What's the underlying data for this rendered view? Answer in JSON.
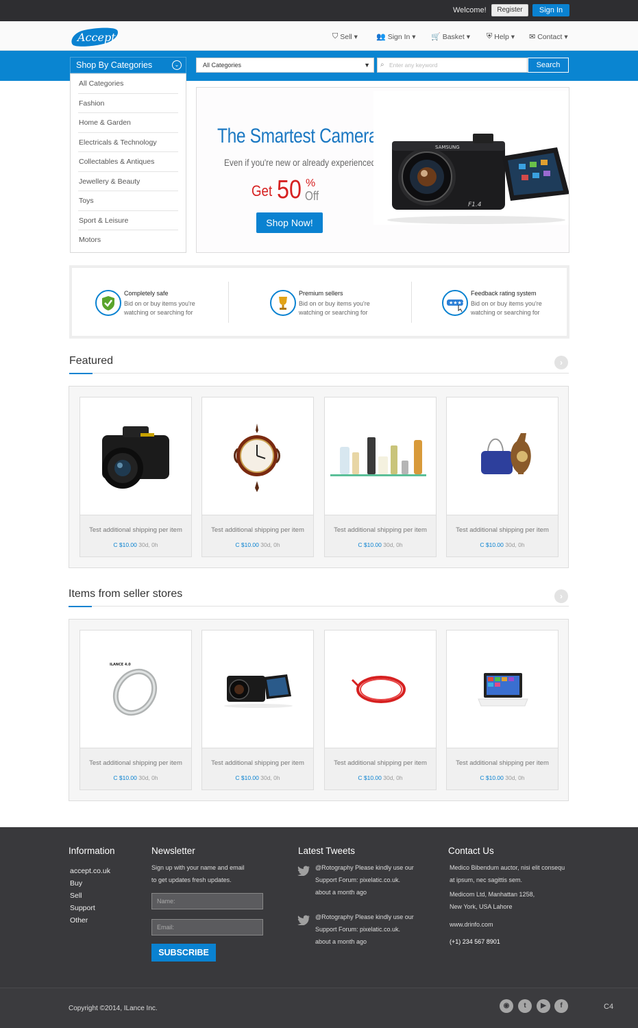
{
  "topbar": {
    "welcome": "Welcome!",
    "register": "Register",
    "signin": "Sign In"
  },
  "header": {
    "logo": "Accept",
    "nav": [
      {
        "icon": "tag-icon",
        "label": "Sell ▾"
      },
      {
        "icon": "users-icon",
        "label": "Sign In ▾"
      },
      {
        "icon": "cart-icon",
        "label": "Basket ▾"
      },
      {
        "icon": "shield-icon",
        "label": "Help ▾"
      },
      {
        "icon": "envelope-icon",
        "label": "Contact ▾"
      }
    ]
  },
  "search": {
    "categories_title": "Shop By Categories",
    "category_select": "All Categories",
    "placeholder": "Enter any keyword",
    "button": "Search"
  },
  "categories": [
    "All Categories",
    "Fashion",
    "Home & Garden",
    "Electricals & Technology",
    "Collectables & Antiques",
    "Jewellery & Beauty",
    "Toys",
    "Sport & Leisure",
    "Motors"
  ],
  "banner": {
    "title": "The Smartest Cameras",
    "subtitle": "Even if you're new or already experienced",
    "get": "Get",
    "percent": "50",
    "pct_sign": "%",
    "off": "Off",
    "button": "Shop Now!",
    "camera_brand": "SAMSUNG",
    "camera_model": "F1.4"
  },
  "features": [
    {
      "icon": "shield-check-icon",
      "title": "Completely safe",
      "desc": "Bid on or buy items you're watching or searching for"
    },
    {
      "icon": "trophy-icon",
      "title": "Premium sellers",
      "desc": "Bid on or buy items you're watching or searching for"
    },
    {
      "icon": "rating-icon",
      "title": "Feedback rating system",
      "desc": "Bid on or buy items you're watching or searching for"
    }
  ],
  "featured": {
    "title": "Featured",
    "items": [
      {
        "image": "dslr-camera",
        "desc": "Test additional shipping per item",
        "price": "C $10.00",
        "time": "30d, 0h"
      },
      {
        "image": "wall-clock",
        "desc": "Test additional shipping per item",
        "price": "C $10.00",
        "time": "30d, 0h"
      },
      {
        "image": "bath-products",
        "desc": "Test additional shipping per item",
        "price": "C $10.00",
        "time": "30d, 0h"
      },
      {
        "image": "handbag-vase",
        "desc": "Test additional shipping per item",
        "price": "C $10.00",
        "time": "30d, 0h"
      }
    ]
  },
  "seller": {
    "title": "Items from seller stores",
    "items": [
      {
        "image": "ring",
        "label": "ILANCE 4.0",
        "desc": "Test additional shipping per item",
        "price": "C $10.00",
        "time": "30d, 0h"
      },
      {
        "image": "compact-camera",
        "desc": "Test additional shipping per item",
        "price": "C $10.00",
        "time": "30d, 0h"
      },
      {
        "image": "red-cable",
        "desc": "Test additional shipping per item",
        "price": "C $10.00",
        "time": "30d, 0h"
      },
      {
        "image": "tablet",
        "desc": "Test additional shipping per item",
        "price": "C $10.00",
        "time": "30d, 0h"
      }
    ]
  },
  "footer": {
    "info_title": "Information",
    "info_links": [
      "accept.co.uk",
      "Buy",
      "Sell",
      "Support",
      "Other"
    ],
    "newsletter_title": "Newsletter",
    "newsletter_text1": "Sign up with your name and email",
    "newsletter_text2": "to get updates fresh updates.",
    "name_placeholder": "Name:",
    "email_placeholder": "Email:",
    "subscribe": "SUBSCRIBE",
    "tweets_title": "Latest Tweets",
    "tweets": [
      {
        "line1": "@Rotography Please kindly use our",
        "line2": "Support Forum:  pixelatic.co.uk.",
        "time": "about a month ago"
      },
      {
        "line1": "@Rotography Please kindly use our",
        "line2": "Support Forum:  pixelatic.co.uk.",
        "time": "about a month ago"
      }
    ],
    "contact_title": "Contact Us",
    "contact_text1": "Medico Bibendum auctor, nisi elit consequ",
    "contact_text2": "at ipsum, nec sagittis sem.",
    "address1": "Medicom Ltd, Manhattan 1258,",
    "address2": "New York, USA Lahore",
    "website": "www.drinfo.com",
    "phone": "(+1) 234 567 8901"
  },
  "bottom": {
    "copyright": "Copyright ©2014, ILance Inc.",
    "code": "C4",
    "social": [
      "rss-icon",
      "twitter-icon",
      "youtube-icon",
      "facebook-icon"
    ]
  },
  "colors": {
    "brand": "#0a82d1",
    "dark": "#39393c",
    "sale": "#d62121"
  }
}
